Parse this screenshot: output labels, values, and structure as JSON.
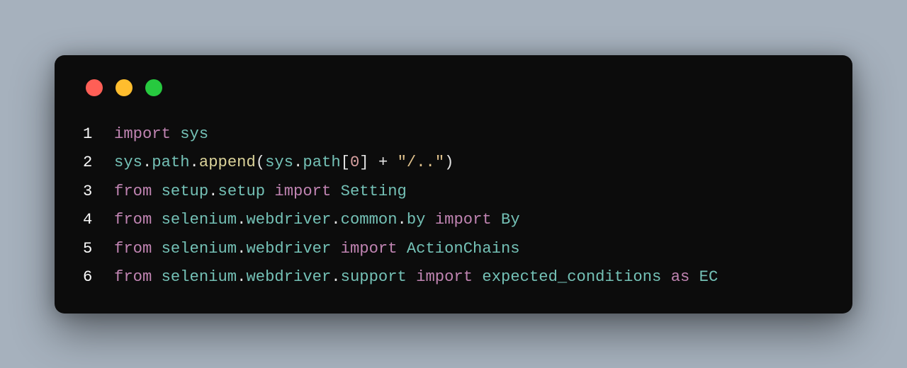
{
  "colors": {
    "page_bg": "#a6b1bd",
    "window_bg": "#0c0c0c",
    "traffic_red": "#ff5f56",
    "traffic_yellow": "#ffbd2e",
    "traffic_green": "#27c93f",
    "line_number": "#fafafa",
    "keyword": "#c084b2",
    "module": "#74c1b6",
    "function": "#dbd39a",
    "string": "#e0c28c",
    "number": "#d8a0a0",
    "punct": "#e5e5e5"
  },
  "code": {
    "lines": [
      {
        "n": "1",
        "tokens": [
          {
            "t": "import",
            "c": "kw"
          },
          {
            "t": " ",
            "c": "pun"
          },
          {
            "t": "sys",
            "c": "mod"
          }
        ]
      },
      {
        "n": "2",
        "tokens": [
          {
            "t": "sys",
            "c": "mod"
          },
          {
            "t": ".",
            "c": "pun"
          },
          {
            "t": "path",
            "c": "mod"
          },
          {
            "t": ".",
            "c": "pun"
          },
          {
            "t": "append",
            "c": "fn"
          },
          {
            "t": "(",
            "c": "pun"
          },
          {
            "t": "sys",
            "c": "mod"
          },
          {
            "t": ".",
            "c": "pun"
          },
          {
            "t": "path",
            "c": "mod"
          },
          {
            "t": "[",
            "c": "pun"
          },
          {
            "t": "0",
            "c": "num"
          },
          {
            "t": "]",
            "c": "pun"
          },
          {
            "t": " + ",
            "c": "pun"
          },
          {
            "t": "\"/..\"",
            "c": "str"
          },
          {
            "t": ")",
            "c": "pun"
          }
        ]
      },
      {
        "n": "3",
        "tokens": [
          {
            "t": "from",
            "c": "kw"
          },
          {
            "t": " ",
            "c": "pun"
          },
          {
            "t": "setup",
            "c": "mod"
          },
          {
            "t": ".",
            "c": "pun"
          },
          {
            "t": "setup",
            "c": "mod"
          },
          {
            "t": " ",
            "c": "pun"
          },
          {
            "t": "import",
            "c": "kw"
          },
          {
            "t": " ",
            "c": "pun"
          },
          {
            "t": "Setting",
            "c": "mod"
          }
        ]
      },
      {
        "n": "4",
        "tokens": [
          {
            "t": "from",
            "c": "kw"
          },
          {
            "t": " ",
            "c": "pun"
          },
          {
            "t": "selenium",
            "c": "mod"
          },
          {
            "t": ".",
            "c": "pun"
          },
          {
            "t": "webdriver",
            "c": "mod"
          },
          {
            "t": ".",
            "c": "pun"
          },
          {
            "t": "common",
            "c": "mod"
          },
          {
            "t": ".",
            "c": "pun"
          },
          {
            "t": "by",
            "c": "mod"
          },
          {
            "t": " ",
            "c": "pun"
          },
          {
            "t": "import",
            "c": "kw"
          },
          {
            "t": " ",
            "c": "pun"
          },
          {
            "t": "By",
            "c": "mod"
          }
        ]
      },
      {
        "n": "5",
        "tokens": [
          {
            "t": "from",
            "c": "kw"
          },
          {
            "t": " ",
            "c": "pun"
          },
          {
            "t": "selenium",
            "c": "mod"
          },
          {
            "t": ".",
            "c": "pun"
          },
          {
            "t": "webdriver",
            "c": "mod"
          },
          {
            "t": " ",
            "c": "pun"
          },
          {
            "t": "import",
            "c": "kw"
          },
          {
            "t": " ",
            "c": "pun"
          },
          {
            "t": "ActionChains",
            "c": "mod"
          }
        ]
      },
      {
        "n": "6",
        "tokens": [
          {
            "t": "from",
            "c": "kw"
          },
          {
            "t": " ",
            "c": "pun"
          },
          {
            "t": "selenium",
            "c": "mod"
          },
          {
            "t": ".",
            "c": "pun"
          },
          {
            "t": "webdriver",
            "c": "mod"
          },
          {
            "t": ".",
            "c": "pun"
          },
          {
            "t": "support",
            "c": "mod"
          },
          {
            "t": " ",
            "c": "pun"
          },
          {
            "t": "import",
            "c": "kw"
          },
          {
            "t": " ",
            "c": "pun"
          },
          {
            "t": "expected_conditions",
            "c": "mod"
          },
          {
            "t": " ",
            "c": "pun"
          },
          {
            "t": "as",
            "c": "kw"
          },
          {
            "t": " ",
            "c": "pun"
          },
          {
            "t": "EC",
            "c": "mod"
          }
        ]
      }
    ]
  }
}
